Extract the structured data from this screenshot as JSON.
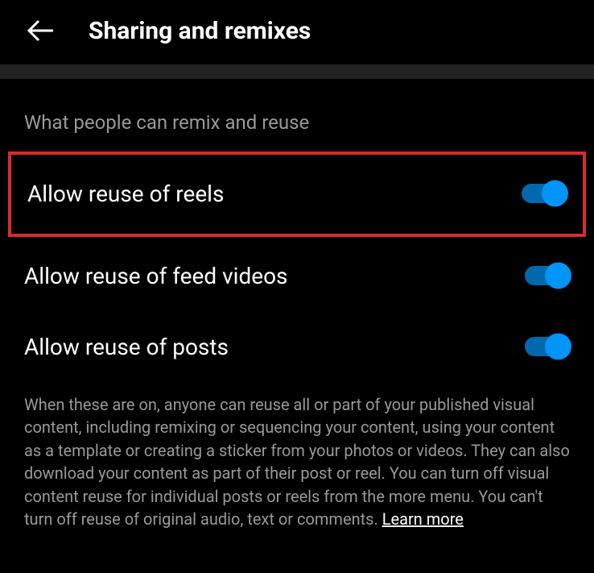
{
  "header": {
    "title": "Sharing and remixes"
  },
  "section": {
    "label": "What people can remix and reuse"
  },
  "settings": [
    {
      "label": "Allow reuse of reels",
      "on": true,
      "highlighted": true
    },
    {
      "label": "Allow reuse of feed videos",
      "on": true,
      "highlighted": false
    },
    {
      "label": "Allow reuse of posts",
      "on": true,
      "highlighted": false
    }
  ],
  "description": {
    "text": "When these are on, anyone can reuse all or part of your published visual content, including remixing or sequencing your content, using your content as a template or creating a sticker from your photos or videos. They can also download your content as part of their post or reel. You can turn off visual content reuse for individual posts or reels from the more menu. You can't turn off reuse of original audio, text or comments. ",
    "learn_more": "Learn more"
  }
}
